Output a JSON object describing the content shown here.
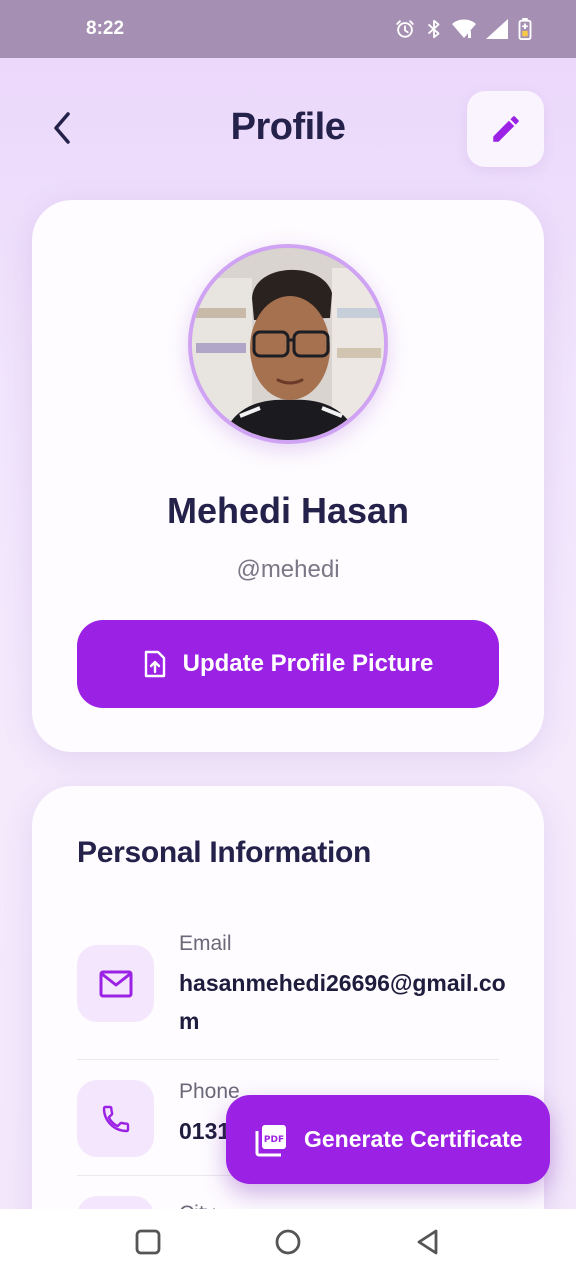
{
  "status_bar": {
    "time": "8:22"
  },
  "header": {
    "title": "Profile"
  },
  "profile": {
    "name": "Mehedi Hasan",
    "handle": "@mehedi",
    "update_button_label": "Update Profile Picture"
  },
  "personal_info": {
    "title": "Personal Information",
    "items": [
      {
        "label": "Email",
        "value": "hasanmehedi26696@gmail.com",
        "icon": "mail-icon"
      },
      {
        "label": "Phone",
        "value": "0131",
        "icon": "phone-icon"
      },
      {
        "label": "City",
        "value": "",
        "icon": "location-icon"
      }
    ]
  },
  "fab": {
    "label": "Generate Certificate",
    "icon": "pdf-icon"
  },
  "colors": {
    "accent": "#9B22E4",
    "title": "#24214A",
    "icon_bg": "#F4E6FD"
  }
}
